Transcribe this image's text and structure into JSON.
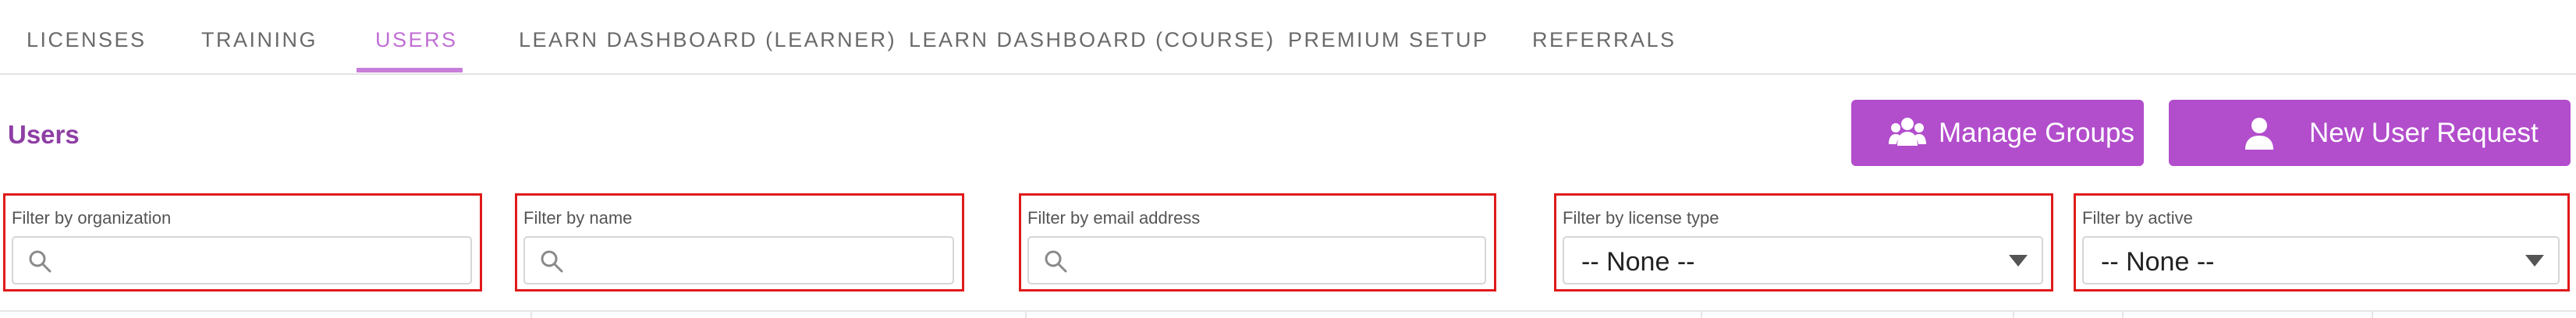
{
  "tabs": [
    {
      "label": "LICENSES",
      "active": false
    },
    {
      "label": "TRAINING",
      "active": false
    },
    {
      "label": "USERS",
      "active": true
    },
    {
      "label": "LEARN DASHBOARD (LEARNER)",
      "active": false
    },
    {
      "label": "LEARN DASHBOARD (COURSE)",
      "active": false
    },
    {
      "label": "PREMIUM SETUP",
      "active": false
    },
    {
      "label": "REFERRALS",
      "active": false
    }
  ],
  "page": {
    "title": "Users"
  },
  "actions": {
    "manage_groups_label": "Manage Groups",
    "manage_groups_icon": "users-group-icon",
    "new_user_label": "New User Request",
    "new_user_icon": "user-icon"
  },
  "filters": {
    "organization": {
      "label": "Filter by organization",
      "value": ""
    },
    "name": {
      "label": "Filter by name",
      "value": ""
    },
    "email": {
      "label": "Filter by email address",
      "value": ""
    },
    "license_type": {
      "label": "Filter by license type",
      "value": "-- None --"
    },
    "active": {
      "label": "Filter by active",
      "value": "-- None --"
    }
  },
  "colors": {
    "accent": "#b24dcc",
    "title": "#8e3ea4",
    "active_tab": "#c06fd4",
    "highlight_border": "#e01a1a"
  }
}
